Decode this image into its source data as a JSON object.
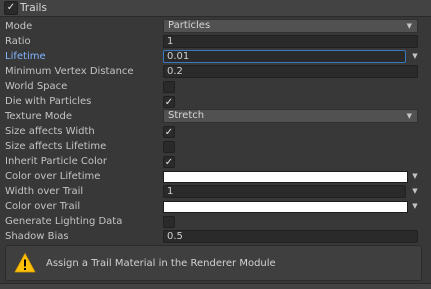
{
  "header": {
    "title": "Trails",
    "enabled": "✓"
  },
  "rows": {
    "mode": {
      "label": "Mode",
      "value": "Particles"
    },
    "ratio": {
      "label": "Ratio",
      "value": "1"
    },
    "lifetime": {
      "label": "Lifetime",
      "value": "0.01"
    },
    "min_vertex_distance": {
      "label": "Minimum Vertex Distance",
      "value": "0.2"
    },
    "world_space": {
      "label": "World Space",
      "checked": ""
    },
    "die_with_particles": {
      "label": "Die with Particles",
      "checked": "✓"
    },
    "texture_mode": {
      "label": "Texture Mode",
      "value": "Stretch"
    },
    "size_affects_width": {
      "label": "Size affects Width",
      "checked": "✓"
    },
    "size_affects_lifetime": {
      "label": "Size affects Lifetime",
      "checked": ""
    },
    "inherit_particle_color": {
      "label": "Inherit Particle Color",
      "checked": "✓"
    },
    "color_over_lifetime": {
      "label": "Color over Lifetime",
      "color": "#ffffff"
    },
    "width_over_trail": {
      "label": "Width over Trail",
      "value": "1"
    },
    "color_over_trail": {
      "label": "Color over Trail",
      "color": "#ffffff"
    },
    "generate_lighting_data": {
      "label": "Generate Lighting Data",
      "checked": ""
    },
    "shadow_bias": {
      "label": "Shadow Bias",
      "value": "0.5"
    }
  },
  "help": {
    "message": "Assign a Trail Material in the Renderer Module",
    "icon": "warning-icon"
  },
  "colors": {
    "accent": "#3a79bb",
    "label_highlight": "#81b4ff",
    "background": "#383838"
  }
}
